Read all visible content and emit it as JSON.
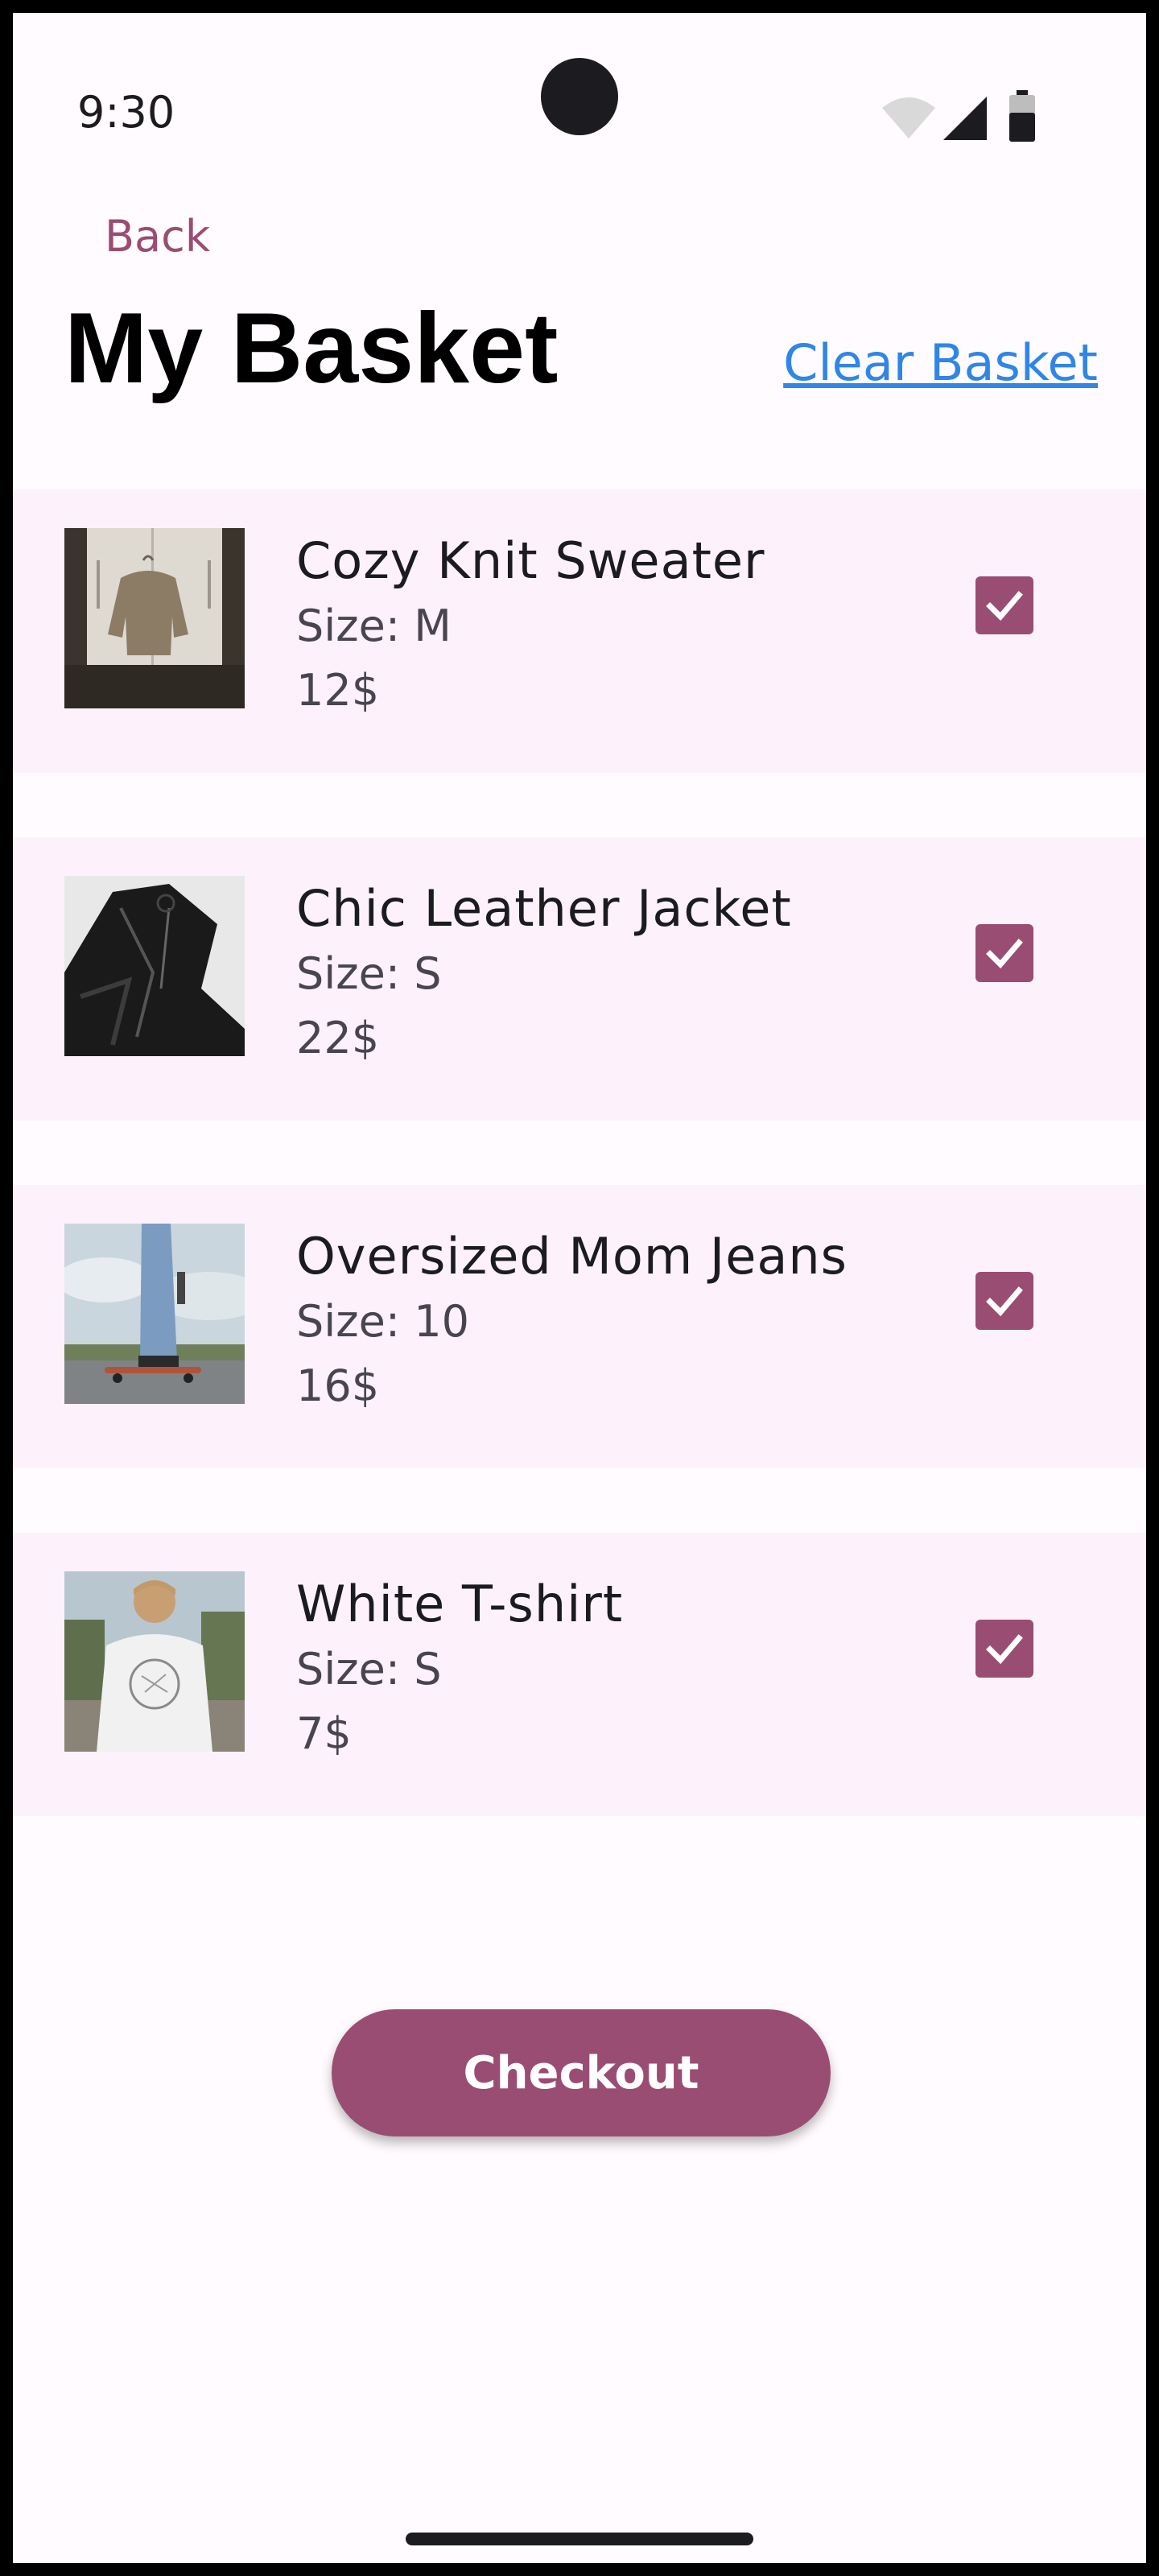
{
  "status_bar": {
    "time": "9:30",
    "icons": [
      "wifi-icon",
      "signal-icon",
      "battery-icon"
    ]
  },
  "header": {
    "back_label": "Back",
    "title": "My Basket",
    "clear_label": "Clear Basket"
  },
  "items": [
    {
      "name": "Cozy Knit Sweater",
      "size": "Size: M",
      "price": "12$",
      "checked": true,
      "image": "knit-sweater-on-hanger"
    },
    {
      "name": "Chic Leather Jacket",
      "size": "Size: S",
      "price": "22$",
      "checked": true,
      "image": "black-leather-jacket"
    },
    {
      "name": "Oversized Mom Jeans",
      "size": "Size: 10",
      "price": "16$",
      "checked": true,
      "image": "jeans-on-skateboard"
    },
    {
      "name": "White T-shirt",
      "size": "Size: S",
      "price": "7$",
      "checked": true,
      "image": "person-in-white-tshirt"
    }
  ],
  "checkout_label": "Checkout",
  "colors": {
    "accent": "#9a4d72",
    "item_background": "#fdf2fb",
    "screen_background": "#fffbfe",
    "link": "#2f86e6"
  }
}
